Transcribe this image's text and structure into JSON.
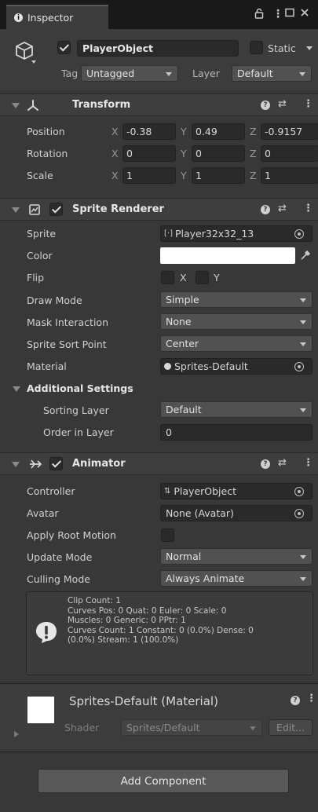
{
  "tab": {
    "title": "Inspector"
  },
  "object": {
    "active": true,
    "name": "PlayerObject",
    "static_label": "Static",
    "tag_label": "Tag",
    "tag_value": "Untagged",
    "layer_label": "Layer",
    "layer_value": "Default"
  },
  "transform": {
    "title": "Transform",
    "rows": [
      {
        "label": "Position",
        "x": "-0.38",
        "y": "0.49",
        "z": "-0.9157"
      },
      {
        "label": "Rotation",
        "x": "0",
        "y": "0",
        "z": "0"
      },
      {
        "label": "Scale",
        "x": "1",
        "y": "1",
        "z": "1"
      }
    ],
    "axes": {
      "x": "X",
      "y": "Y",
      "z": "Z"
    }
  },
  "sprite_renderer": {
    "enabled": true,
    "title": "Sprite Renderer",
    "sprite_label": "Sprite",
    "sprite_value": "Player32x32_13",
    "color_label": "Color",
    "color_value": "#ffffff",
    "flip_label": "Flip",
    "flip_x": "X",
    "flip_y": "Y",
    "draw_mode_label": "Draw Mode",
    "draw_mode_value": "Simple",
    "mask_label": "Mask Interaction",
    "mask_value": "None",
    "sort_point_label": "Sprite Sort Point",
    "sort_point_value": "Center",
    "material_label": "Material",
    "material_value": "Sprites-Default",
    "additional_label": "Additional Settings",
    "sorting_layer_label": "Sorting Layer",
    "sorting_layer_value": "Default",
    "order_label": "Order in Layer",
    "order_value": "0"
  },
  "animator": {
    "enabled": true,
    "title": "Animator",
    "controller_label": "Controller",
    "controller_value": "PlayerObject",
    "avatar_label": "Avatar",
    "avatar_value": "None (Avatar)",
    "root_motion_label": "Apply Root Motion",
    "update_label": "Update Mode",
    "update_value": "Normal",
    "culling_label": "Culling Mode",
    "culling_value": "Always Animate",
    "info_lines": [
      "Clip Count: 1",
      "Curves Pos: 0 Quat: 0 Euler: 0 Scale: 0",
      "Muscles: 0 Generic: 0 PPtr: 1",
      "Curves Count: 1 Constant: 0 (0.0%) Dense: 0",
      "(0.0%) Stream: 1 (100.0%)"
    ]
  },
  "material": {
    "title": "Sprites-Default (Material)",
    "shader_label": "Shader",
    "shader_value": "Sprites/Default",
    "edit_label": "Edit..."
  },
  "add_component_label": "Add Component",
  "colors": {
    "panel": "#383838",
    "header": "#3e3e3e",
    "field": "#2a2a2a",
    "dropdown": "#515151"
  }
}
